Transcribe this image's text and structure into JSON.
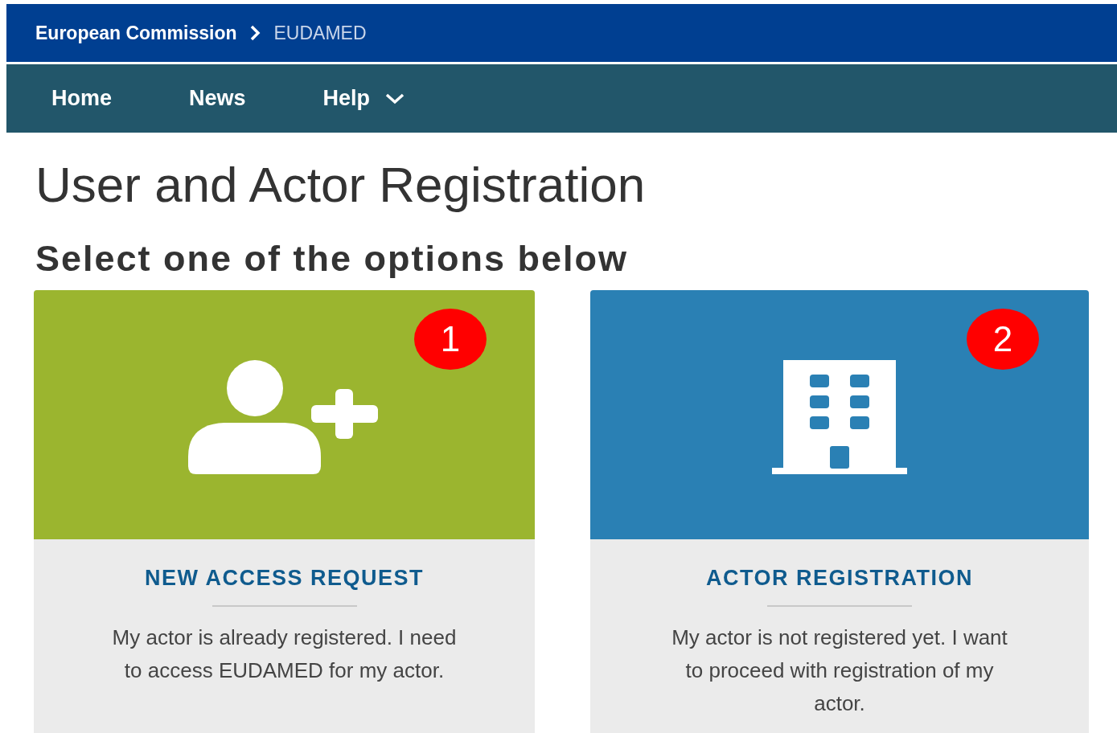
{
  "breadcrumb": [
    {
      "label": "European Commission"
    },
    {
      "label": "EUDAMED"
    }
  ],
  "nav": [
    {
      "label": "Home",
      "has_menu": false
    },
    {
      "label": "News",
      "has_menu": false
    },
    {
      "label": "Help",
      "has_menu": true
    }
  ],
  "title": "User and Actor Registration",
  "subtitle": "Select one of the options below",
  "options": [
    {
      "kind": "user",
      "number": "1",
      "color": "#9bb52f",
      "title": "NEW ACCESS REQUEST",
      "description": "My actor is already registered. I need to access EUDAMED for my actor."
    },
    {
      "kind": "building",
      "number": "2",
      "color": "#2a80b4",
      "title": "ACTOR REGISTRATION",
      "description": "My actor is not registered yet. I want to proceed with registration of my actor."
    }
  ]
}
